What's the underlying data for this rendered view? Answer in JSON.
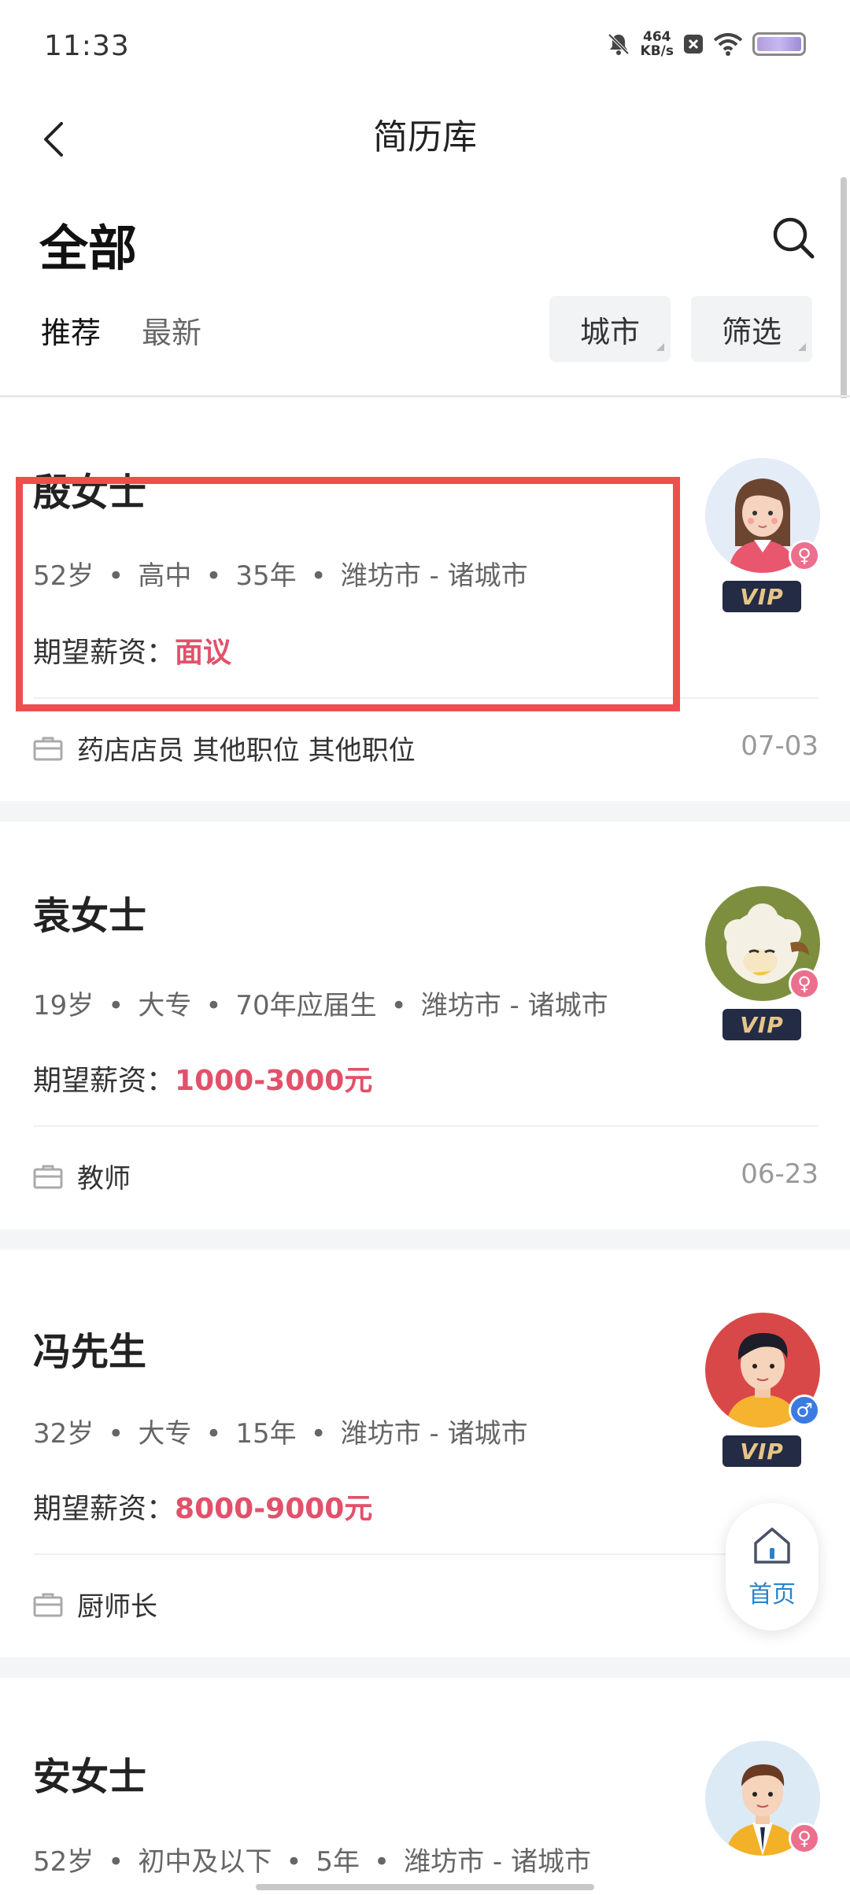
{
  "status_bar": {
    "time": "11:33",
    "speed_value": "464",
    "speed_unit": "KB/s"
  },
  "nav": {
    "title": "简历库"
  },
  "header": {
    "heading": "全部",
    "tabs": [
      {
        "label": "推荐",
        "active": true
      },
      {
        "label": "最新",
        "active": false
      }
    ],
    "city_button": "城市",
    "filter_button": "筛选"
  },
  "cards": [
    {
      "name": "殷女士",
      "age": "52岁",
      "education": "高中",
      "experience": "35年",
      "location": "潍坊市 - 诸城市",
      "salary_label": "期望薪资：",
      "salary_value": "面议",
      "job": "药店店员 其他职位 其他职位",
      "date": "07-03",
      "gender": "female",
      "vip_label": "VIP"
    },
    {
      "name": "袁女士",
      "age": "19岁",
      "education": "大专",
      "experience": "70年应届生",
      "location": "潍坊市 - 诸城市",
      "salary_label": "期望薪资：",
      "salary_value": "1000-3000元",
      "job": "教师",
      "date": "06-23",
      "gender": "female",
      "vip_label": "VIP"
    },
    {
      "name": "冯先生",
      "age": "32岁",
      "education": "大专",
      "experience": "15年",
      "location": "潍坊市 - 诸城市",
      "salary_label": "期望薪资：",
      "salary_value": "8000-9000元",
      "job": "厨师长",
      "date": "",
      "gender": "male",
      "vip_label": "VIP"
    },
    {
      "name": "安女士",
      "age": "52岁",
      "education": "初中及以下",
      "experience": "5年",
      "location": "潍坊市 - 诸城市",
      "gender": "female"
    }
  ],
  "fab": {
    "home_label": "首页"
  },
  "colors": {
    "salary": "#e2516a",
    "highlight": "#ee4e4e",
    "vip_bg": "#232b45",
    "home_blue": "#2a83c9"
  }
}
